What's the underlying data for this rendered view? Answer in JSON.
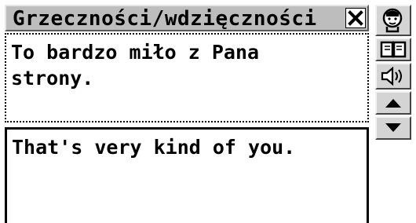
{
  "window": {
    "title": "Grzeczności/wdzięczności",
    "close_icon": "close-icon"
  },
  "source": {
    "text": "To bardzo miło z Pana\nstrony."
  },
  "translation": {
    "text": "That's very kind of you."
  },
  "sidebar": {
    "buttons": [
      {
        "icon": "speaker-head-icon"
      },
      {
        "icon": "book-icon"
      },
      {
        "icon": "sound-icon"
      },
      {
        "icon": "arrow-up-icon"
      },
      {
        "icon": "arrow-down-icon"
      }
    ]
  }
}
